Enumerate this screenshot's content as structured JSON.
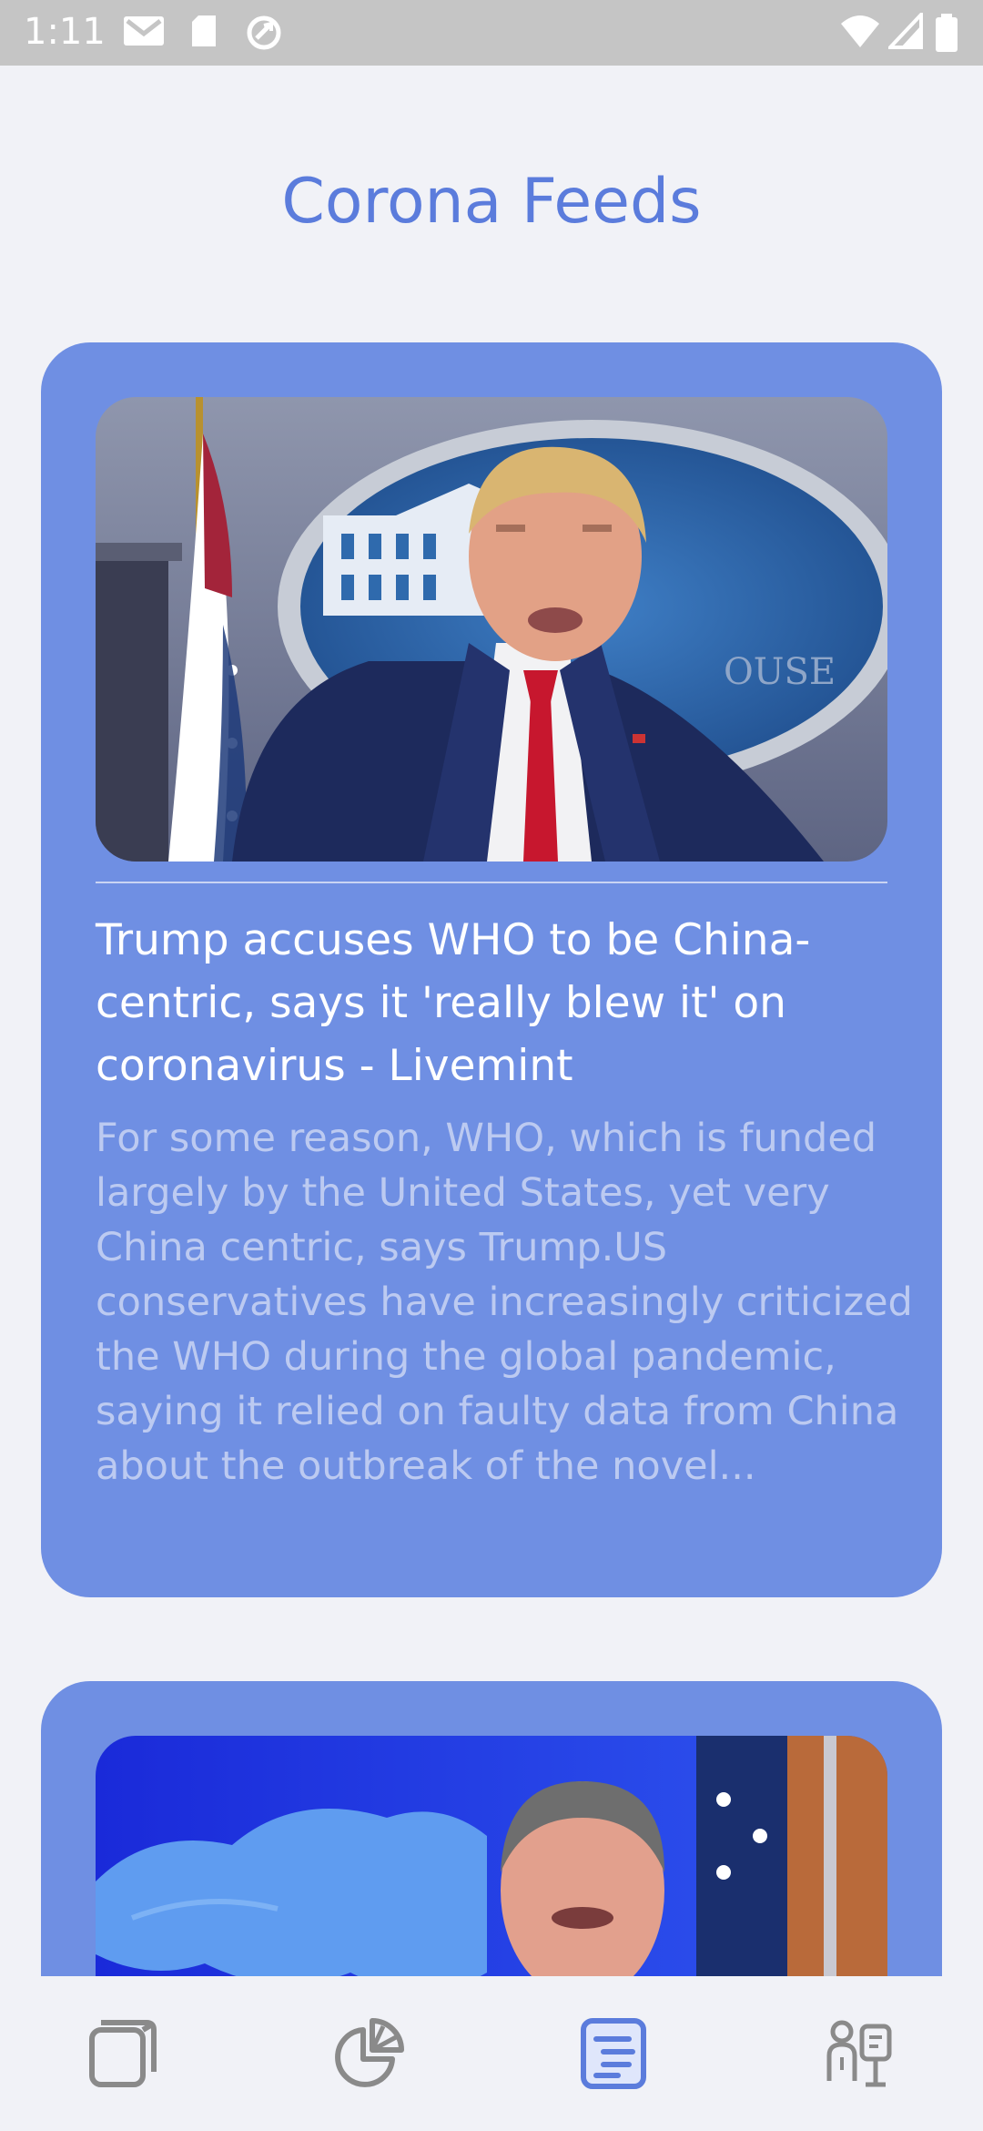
{
  "status_bar": {
    "time": "1:11",
    "icons": [
      "gmail-icon",
      "sd-card-icon",
      "sync-icon",
      "wifi-icon",
      "signal-icon",
      "battery-icon"
    ]
  },
  "header": {
    "title": "Corona Feeds"
  },
  "feed": {
    "items": [
      {
        "headline": "Trump accuses WHO to be China-centric, says it 'really blew it' on coronavirus - Livemint",
        "summary": "For some reason, WHO, which is funded largely by the United States, yet very China centric, says Trump.US conservatives have increasingly criticized the WHO during the global pandemic, saying it relied on faulty data from China about the outbreak of the novel...",
        "image": "press-briefing-photo"
      },
      {
        "headline": "",
        "summary": "",
        "image": "world-map-press-photo"
      }
    ]
  },
  "bottom_nav": {
    "items": [
      {
        "icon": "cube-icon",
        "active": false
      },
      {
        "icon": "pie-chart-icon",
        "active": false
      },
      {
        "icon": "news-list-icon",
        "active": true
      },
      {
        "icon": "doctor-icon",
        "active": false
      }
    ],
    "active_color": "#5b7cdc",
    "inactive_color": "#8a8a8a"
  },
  "colors": {
    "accent": "#5b7cdc",
    "card": "#6f8fe3",
    "background": "#f1f2f7"
  }
}
